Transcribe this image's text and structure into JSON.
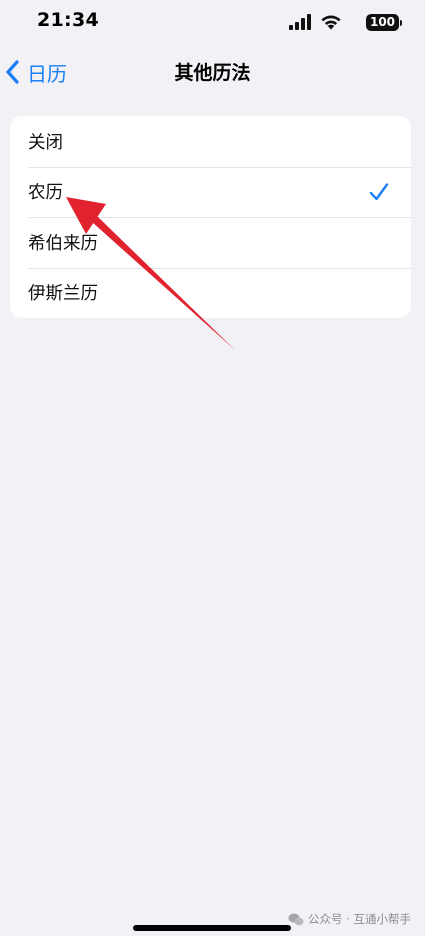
{
  "status_bar": {
    "time": "21:34",
    "battery": "100",
    "icons": [
      "signal-icon",
      "wifi-icon",
      "battery-icon"
    ]
  },
  "nav": {
    "back_label": "日历",
    "title": "其他历法"
  },
  "options": [
    {
      "label": "关闭",
      "selected": false
    },
    {
      "label": "农历",
      "selected": true
    },
    {
      "label": "希伯来历",
      "selected": false
    },
    {
      "label": "伊斯兰历",
      "selected": false
    }
  ],
  "watermark": {
    "text": "公众号 · 互通小帮手"
  },
  "colors": {
    "accent": "#1a7ff4",
    "background": "#f1f1f6",
    "annotation_arrow": "#e0232e"
  }
}
